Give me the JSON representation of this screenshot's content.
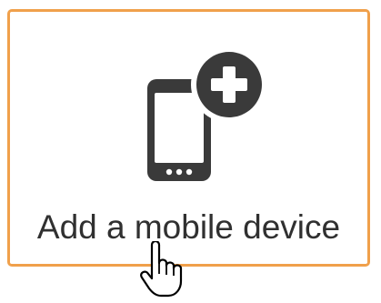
{
  "tile": {
    "label": "Add a mobile device",
    "border_color": "#f0a04b",
    "icon": "mobile-add-icon"
  },
  "cursor": {
    "icon": "hand-pointer-icon"
  }
}
